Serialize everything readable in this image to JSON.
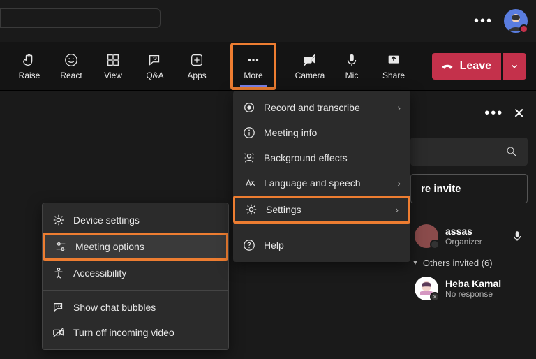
{
  "toolbar": {
    "raise": "Raise",
    "react": "React",
    "view": "View",
    "qa": "Q&A",
    "apps": "Apps",
    "more": "More",
    "camera": "Camera",
    "mic": "Mic",
    "share": "Share",
    "leave": "Leave"
  },
  "more_menu": {
    "record": "Record and transcribe",
    "meeting_info": "Meeting info",
    "background": "Background effects",
    "language": "Language and speech",
    "settings": "Settings",
    "help": "Help"
  },
  "settings_menu": {
    "device": "Device settings",
    "meeting_options": "Meeting options",
    "accessibility": "Accessibility",
    "chat_bubbles": "Show chat bubbles",
    "turn_off_video": "Turn off incoming video"
  },
  "panel": {
    "share_invite": "re invite",
    "organizer_name": "assas",
    "organizer_role": "Organizer",
    "others_label": "Others invited (6)",
    "p1_name": "Heba Kamal",
    "p1_status": "No response"
  }
}
